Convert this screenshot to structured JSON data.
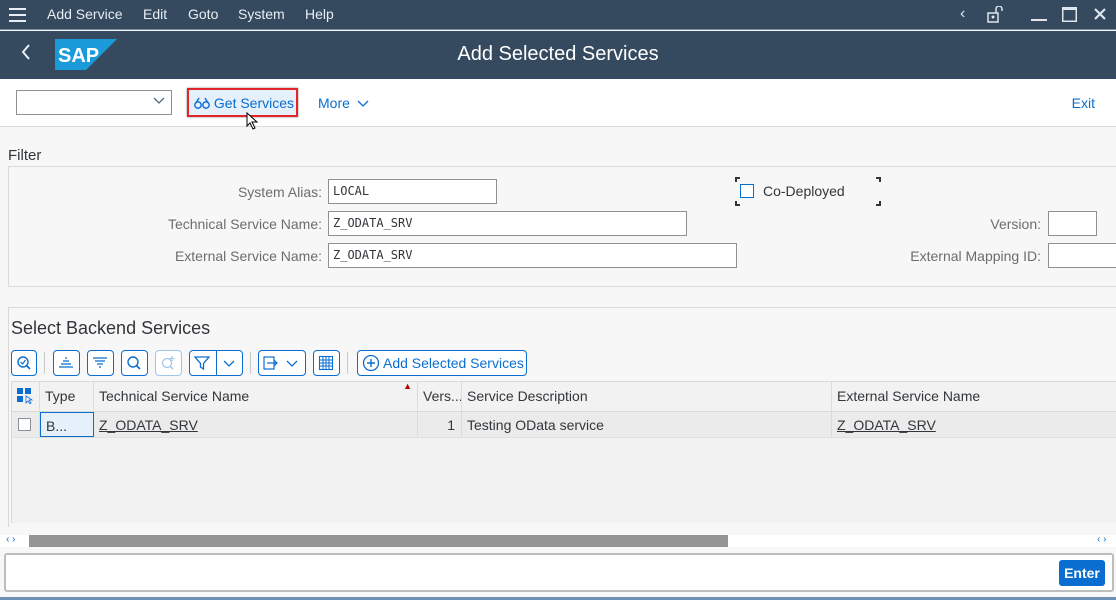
{
  "menubar": {
    "items": [
      "Add Service",
      "Edit",
      "Goto",
      "System",
      "Help"
    ]
  },
  "header": {
    "title": "Add Selected Services",
    "logo_text": "SAP"
  },
  "toolbar": {
    "combo_value": "",
    "get_services_label": "Get Services",
    "more_label": "More",
    "exit_label": "Exit"
  },
  "filter": {
    "section_label": "Filter",
    "system_alias_label": "System Alias:",
    "system_alias_value": "LOCAL",
    "technical_service_name_label": "Technical Service Name:",
    "technical_service_name_value": "Z_ODATA_SRV",
    "external_service_name_label": "External Service Name:",
    "external_service_name_value": "Z_ODATA_SRV",
    "co_deployed_label": "Co-Deployed",
    "co_deployed_checked": false,
    "version_label": "Version:",
    "version_value": "",
    "external_mapping_id_label": "External Mapping ID:",
    "external_mapping_id_value": ""
  },
  "backend": {
    "section_title": "Select Backend Services",
    "add_selected_label": "Add Selected Services",
    "columns": [
      "Type",
      "Technical Service Name",
      "Vers...",
      "Service Description",
      "External Service Name"
    ],
    "rows": [
      {
        "type": "B...",
        "technical_service_name": "Z_ODATA_SRV",
        "version": "1",
        "service_description": "Testing OData service",
        "external_service_name": "Z_ODATA_SRV"
      }
    ]
  },
  "command": {
    "value": "",
    "enter_label": "Enter"
  },
  "colors": {
    "shell": "#354a5f",
    "accent": "#0a6ed1",
    "highlight_border": "#e0262b"
  }
}
